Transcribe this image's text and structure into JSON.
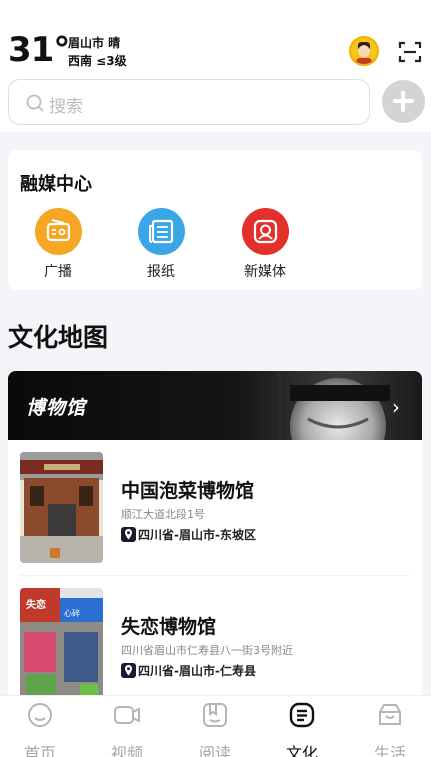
{
  "status": {
    "temperature": "31°",
    "city_weather": "眉山市 晴",
    "wind": "西南 ≤3级"
  },
  "search": {
    "placeholder": "搜索"
  },
  "media_center": {
    "title": "融媒中心",
    "items": [
      {
        "label": "广播",
        "icon": "radio-icon",
        "color": "#f5a623"
      },
      {
        "label": "报纸",
        "icon": "newspaper-icon",
        "color": "#3aa6e8"
      },
      {
        "label": "新媒体",
        "icon": "new-media-icon",
        "color": "#e3302b"
      }
    ]
  },
  "culture_map": {
    "title": "文化地图",
    "banner_label": "博物馆"
  },
  "museums": [
    {
      "name": "中国泡菜博物馆",
      "address": "顺江大道北段1号",
      "region": "四川省-眉山市-东坡区"
    },
    {
      "name": "失恋博物馆",
      "address": "四川省眉山市仁寿县八一街3号附近",
      "region": "四川省-眉山市-仁寿县"
    }
  ],
  "tabs": [
    {
      "label": "首页",
      "icon": "home-icon"
    },
    {
      "label": "视频",
      "icon": "video-icon"
    },
    {
      "label": "阅读",
      "icon": "reading-icon"
    },
    {
      "label": "文化",
      "icon": "culture-icon",
      "active": true
    },
    {
      "label": "生活",
      "icon": "life-icon"
    }
  ],
  "colors": {
    "background": "#f4f5f8",
    "tab_active": "#111111",
    "tab_inactive": "#a7a7a7"
  }
}
